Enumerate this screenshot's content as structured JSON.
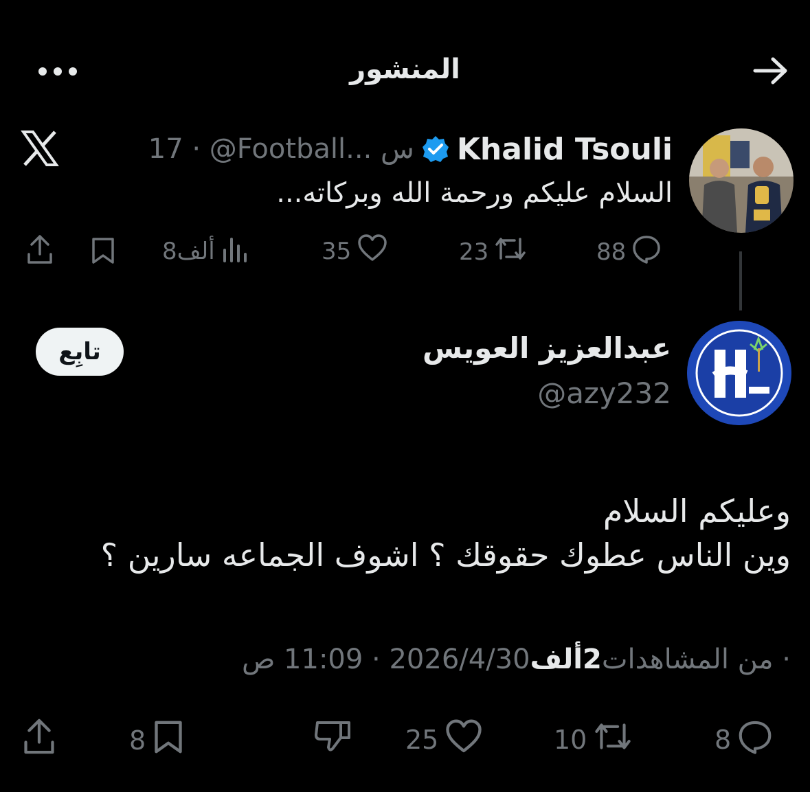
{
  "header": {
    "title": "المنشور",
    "back_icon": "arrow-right-icon",
    "more_icon": "more-horizontal-icon"
  },
  "parent_tweet": {
    "name": "Khalid Tsouli",
    "verified": true,
    "handle": "@Football...",
    "time": "17 س",
    "meta": "17 · @Football... س",
    "text": "السلام عليكم ورحمة الله وبركاته...",
    "platform_icon": "x-logo-icon",
    "actions": {
      "replies": "88",
      "reposts": "23",
      "likes": "35",
      "views": "8ألف"
    }
  },
  "reply_tweet": {
    "name": "عبدالعزيز العويس",
    "handle": "@azy232",
    "follow_label": "تابِع",
    "text_line1": "وعليكم السلام",
    "text_line2": "وين الناس عطوك حقوقك ؟ اشوف الجماعه سارين ؟",
    "timestamp_prefix": "2026/4/30 · 11:09 ص · ",
    "views_count": "2ألف",
    "views_suffix": " من المشاهدات",
    "actions": {
      "replies": "8",
      "reposts": "10",
      "likes": "25",
      "bookmarks": "8"
    }
  },
  "colors": {
    "background": "#000000",
    "text": "#e7e9ea",
    "secondary": "#71767b",
    "verified": "#1d9bf0",
    "follow_bg": "#eff3f4"
  }
}
